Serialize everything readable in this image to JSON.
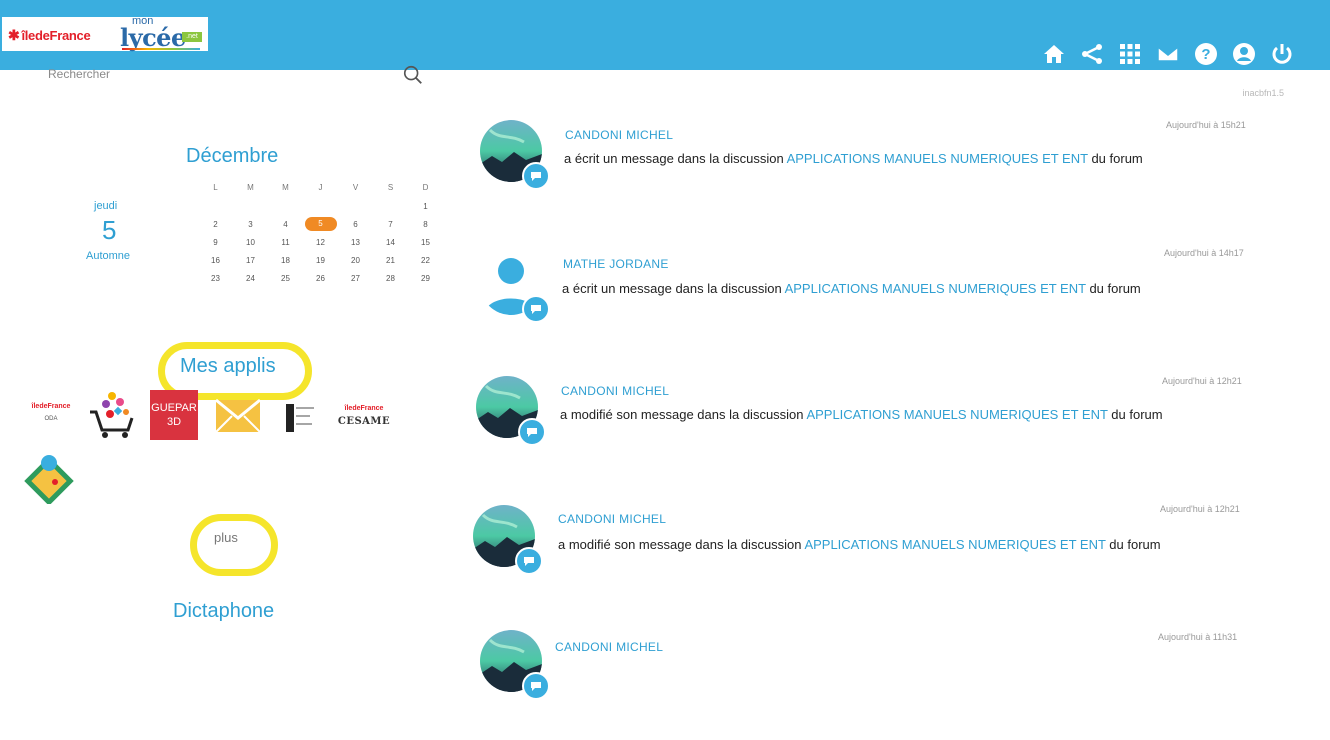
{
  "header": {
    "brand_idf": "îledeFrance",
    "brand_mon": "mon",
    "brand_lycee": "lycée",
    "brand_net": ".net",
    "icons": [
      "home-icon",
      "share-icon",
      "apps-grid-icon",
      "mail-icon",
      "help-icon",
      "user-icon",
      "power-icon"
    ],
    "accent_color": "#3aaedf"
  },
  "search": {
    "placeholder": "Rechercher",
    "version": "inacbfn1.5"
  },
  "calendar": {
    "month": "Décembre",
    "day_name": "jeudi",
    "day_number": "5",
    "season": "Automne",
    "weekdays": [
      "L",
      "M",
      "M",
      "J",
      "V",
      "S",
      "D"
    ],
    "weeks": [
      [
        "",
        "",
        "",
        "",
        "",
        "",
        "1"
      ],
      [
        "2",
        "3",
        "4",
        "5",
        "6",
        "7",
        "8"
      ],
      [
        "9",
        "10",
        "11",
        "12",
        "13",
        "14",
        "15"
      ],
      [
        "16",
        "17",
        "18",
        "19",
        "20",
        "21",
        "22"
      ],
      [
        "23",
        "24",
        "25",
        "26",
        "27",
        "28",
        "29"
      ]
    ],
    "today": "5",
    "today_color": "#f08a24"
  },
  "apps": {
    "title": "Mes applis",
    "oda_brand": "îledeFrance",
    "oda_label": "ODA",
    "guepar_line1": "GUEPAR",
    "guepar_line2": "3D",
    "cesame_brand": "îledeFrance",
    "cesame_label": "CESAME",
    "more": "plus"
  },
  "dictaphone": {
    "title": "Dictaphone"
  },
  "feed": [
    {
      "author": "CANDONI MICHEL",
      "action": "a écrit un message dans la discussion",
      "topic": "APPLICATIONS MANUELS NUMERIQUES ET ENT",
      "suffix": "du forum",
      "time": "Aujourd'hui à 15h21",
      "avatar": "photo"
    },
    {
      "author": "MATHE JORDANE",
      "action": "a écrit un message dans la discussion",
      "topic": "APPLICATIONS MANUELS NUMERIQUES ET ENT",
      "suffix": "du forum",
      "time": "Aujourd'hui à 14h17",
      "avatar": "default"
    },
    {
      "author": "CANDONI MICHEL",
      "action": "a modifié son message dans la discussion",
      "topic": "APPLICATIONS MANUELS NUMERIQUES ET ENT",
      "suffix": "du forum",
      "time": "Aujourd'hui à 12h21",
      "avatar": "photo"
    },
    {
      "author": "CANDONI MICHEL",
      "action": "a modifié son message dans la discussion",
      "topic": "APPLICATIONS MANUELS NUMERIQUES ET ENT",
      "suffix": "du forum",
      "time": "Aujourd'hui à 12h21",
      "avatar": "photo"
    },
    {
      "author": "CANDONI MICHEL",
      "action": "",
      "topic": "",
      "suffix": "",
      "time": "Aujourd'hui à 11h31",
      "avatar": "photo"
    }
  ],
  "highlight_color": "#f5e52b"
}
